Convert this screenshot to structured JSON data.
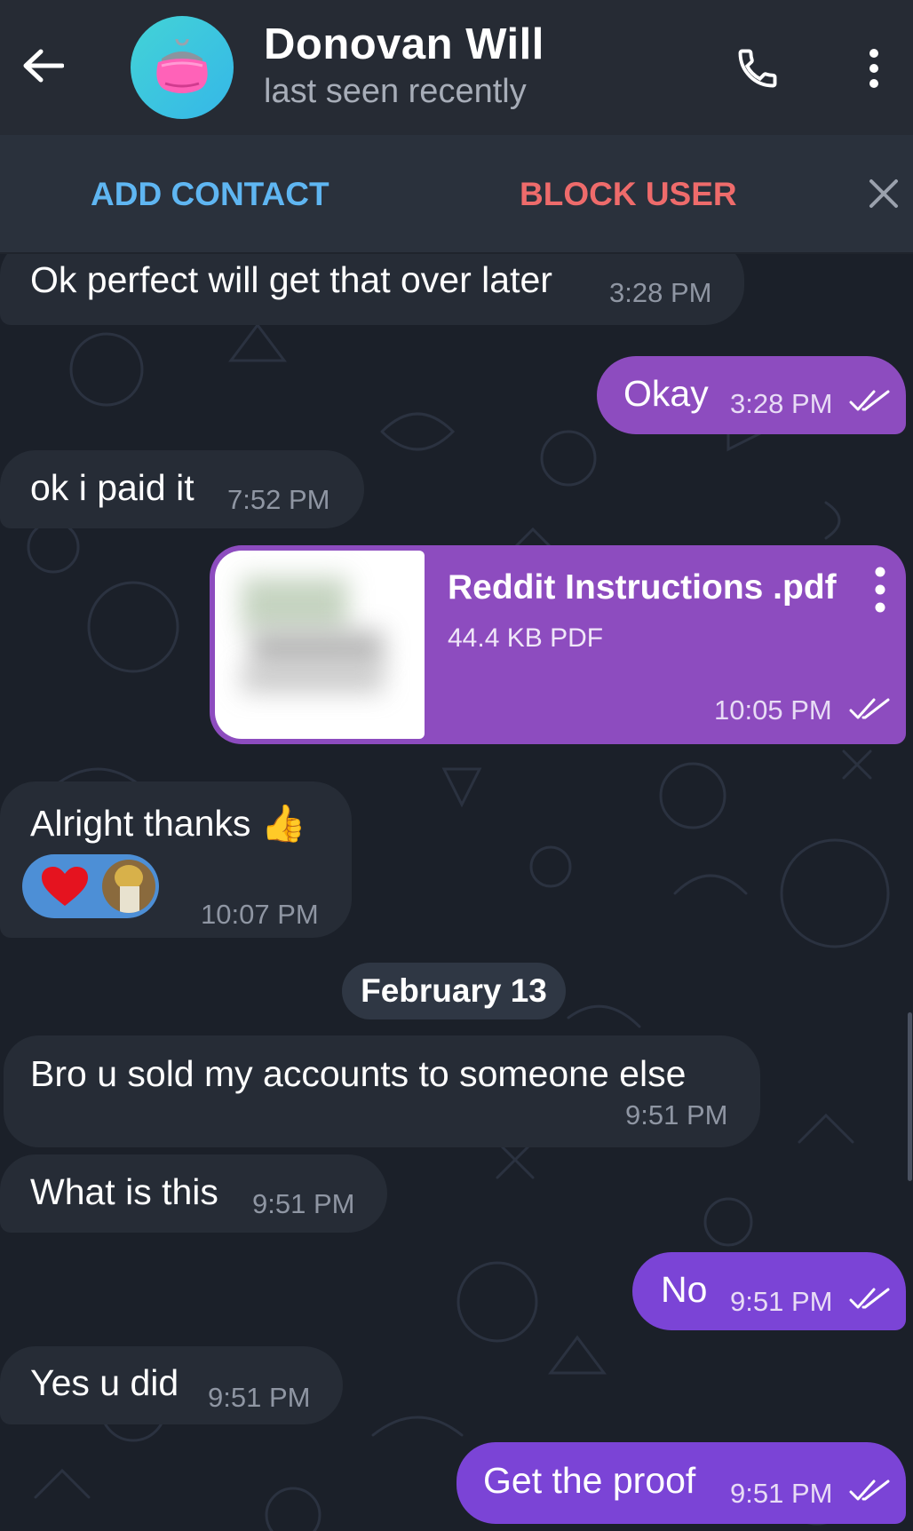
{
  "header": {
    "name": "Donovan Will",
    "status": "last seen recently"
  },
  "action_bar": {
    "add_contact": "ADD CONTACT",
    "block_user": "BLOCK USER"
  },
  "colors": {
    "incoming_bubble": "#262c36",
    "outgoing_bubble": "#8d4cbf",
    "outgoing_bubble_alt": "#7b44d6",
    "link_blue": "#5fb6f2",
    "danger_red": "#ee6b6b"
  },
  "messages": [
    {
      "direction": "in",
      "text": "Ok perfect will get that over later",
      "time": "3:28 PM"
    },
    {
      "direction": "out",
      "text": "Okay",
      "time": "3:28 PM",
      "read": true
    },
    {
      "direction": "in",
      "text": "ok i paid it",
      "time": "7:52 PM"
    },
    {
      "direction": "out",
      "type": "file",
      "file_name": "Reddit Instructions .pdf",
      "file_size": "44.4 KB PDF",
      "time": "10:05 PM",
      "read": true
    },
    {
      "direction": "in",
      "text": "Alright thanks 👍",
      "time": "10:07 PM",
      "reactions": [
        "heart-icon",
        "avatar"
      ]
    },
    {
      "direction": "in",
      "text": "Bro u sold my accounts to someone else",
      "time": "9:51 PM"
    },
    {
      "direction": "in",
      "text": "What is this",
      "time": "9:51 PM"
    },
    {
      "direction": "out",
      "text": "No",
      "time": "9:51 PM",
      "read": true
    },
    {
      "direction": "in",
      "text": "Yes u did",
      "time": "9:51 PM"
    },
    {
      "direction": "out",
      "text": "Get the proof",
      "time": "9:51 PM",
      "read": true
    }
  ],
  "date_separator": "February 13"
}
